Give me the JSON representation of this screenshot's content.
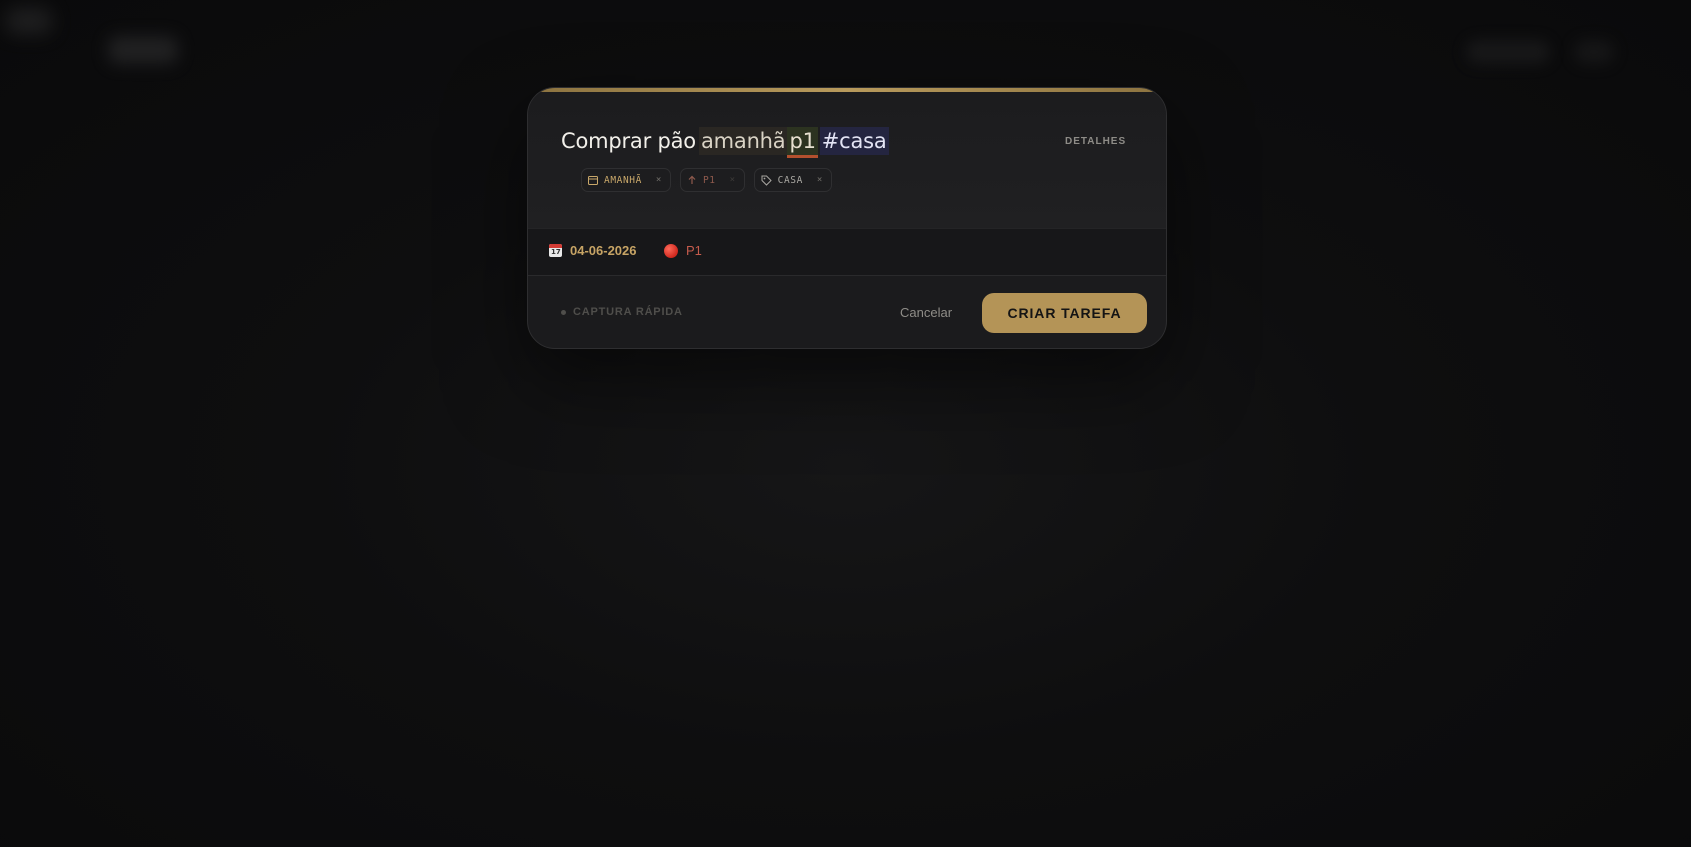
{
  "modal": {
    "task_text": {
      "plain": "Comprar pão",
      "date_token": "amanhã",
      "priority_token": "p1",
      "tag_token": "#casa"
    },
    "details_label": "DETALHES",
    "chips": [
      {
        "icon": "calendar-icon",
        "label": "AMANHÃ",
        "remove": "×"
      },
      {
        "icon": "arrow-up-icon",
        "label": "P1",
        "remove": "×"
      },
      {
        "icon": "tag-icon",
        "label": "CASA",
        "remove": "×"
      }
    ],
    "meta": {
      "date": "04-06-2026",
      "priority": "P1"
    },
    "footer": {
      "quick_capture": "CAPTURA RÁPIDA",
      "cancel_label": "Cancelar",
      "create_label": "CRIAR TAREFA"
    }
  },
  "colors": {
    "accent_gold": "#b49457",
    "priority_red": "#c55b4c"
  }
}
